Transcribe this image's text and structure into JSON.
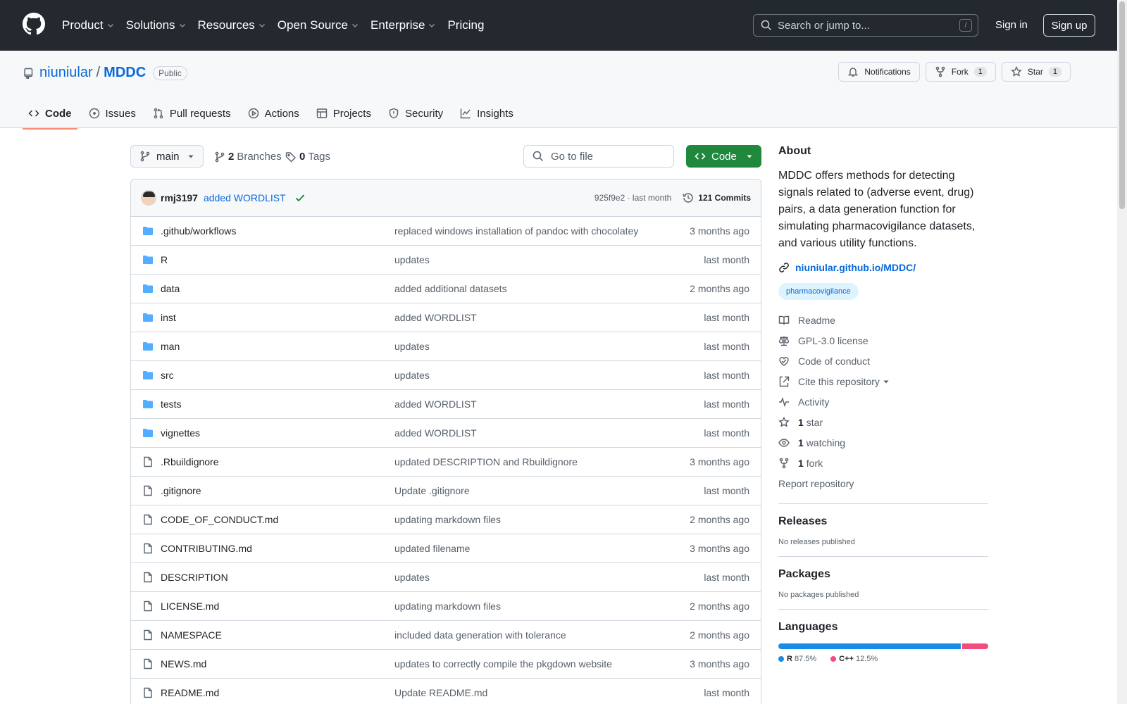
{
  "header": {
    "nav": [
      "Product",
      "Solutions",
      "Resources",
      "Open Source",
      "Enterprise",
      "Pricing"
    ],
    "search_placeholder": "Search or jump to...",
    "search_shortcut": "/",
    "sign_in": "Sign in",
    "sign_up": "Sign up"
  },
  "repo": {
    "owner": "niuniular",
    "separator": "/",
    "name": "MDDC",
    "visibility": "Public",
    "notifications_label": "Notifications",
    "fork_label": "Fork",
    "fork_count": "1",
    "star_label": "Star",
    "star_count": "1"
  },
  "tabs": [
    {
      "label": "Code",
      "icon": "code-icon",
      "active": true
    },
    {
      "label": "Issues",
      "icon": "issue-icon"
    },
    {
      "label": "Pull requests",
      "icon": "pull-request-icon"
    },
    {
      "label": "Actions",
      "icon": "play-icon"
    },
    {
      "label": "Projects",
      "icon": "table-icon"
    },
    {
      "label": "Security",
      "icon": "shield-icon"
    },
    {
      "label": "Insights",
      "icon": "graph-icon"
    }
  ],
  "toolbar": {
    "branch": "main",
    "branches_count": "2",
    "branches_label": "Branches",
    "tags_count": "0",
    "tags_label": "Tags",
    "go_to_file": "Go to file",
    "code_button": "Code"
  },
  "latest_commit": {
    "author": "rmj3197",
    "message": "added WORDLIST",
    "hash_time": "925f9e2 · last month",
    "commits": "121 Commits"
  },
  "files": [
    {
      "name": ".github/workflows",
      "type": "folder",
      "message": "replaced windows installation of pandoc with chocolatey",
      "date": "3 months ago"
    },
    {
      "name": "R",
      "type": "folder",
      "message": "updates",
      "date": "last month"
    },
    {
      "name": "data",
      "type": "folder",
      "message": "added additional datasets",
      "date": "2 months ago"
    },
    {
      "name": "inst",
      "type": "folder",
      "message": "added WORDLIST",
      "date": "last month"
    },
    {
      "name": "man",
      "type": "folder",
      "message": "updates",
      "date": "last month"
    },
    {
      "name": "src",
      "type": "folder",
      "message": "updates",
      "date": "last month"
    },
    {
      "name": "tests",
      "type": "folder",
      "message": "added WORDLIST",
      "date": "last month"
    },
    {
      "name": "vignettes",
      "type": "folder",
      "message": "added WORDLIST",
      "date": "last month"
    },
    {
      "name": ".Rbuildignore",
      "type": "file",
      "message": "updated DESCRIPTION and Rbuildignore",
      "date": "3 months ago"
    },
    {
      "name": ".gitignore",
      "type": "file",
      "message": "Update .gitignore",
      "date": "last month"
    },
    {
      "name": "CODE_OF_CONDUCT.md",
      "type": "file",
      "message": "updating markdown files",
      "date": "2 months ago"
    },
    {
      "name": "CONTRIBUTING.md",
      "type": "file",
      "message": "updated filename",
      "date": "3 months ago"
    },
    {
      "name": "DESCRIPTION",
      "type": "file",
      "message": "updates",
      "date": "last month"
    },
    {
      "name": "LICENSE.md",
      "type": "file",
      "message": "updating markdown files",
      "date": "2 months ago"
    },
    {
      "name": "NAMESPACE",
      "type": "file",
      "message": "included data generation with tolerance",
      "date": "2 months ago"
    },
    {
      "name": "NEWS.md",
      "type": "file",
      "message": "updates to correctly compile the pkgdown website",
      "date": "3 months ago"
    },
    {
      "name": "README.md",
      "type": "file",
      "message": "Update README.md",
      "date": "last month"
    }
  ],
  "about": {
    "heading": "About",
    "description": "MDDC offers methods for detecting signals related to (adverse event, drug) pairs, a data generation function for simulating pharmacovigilance datasets, and various utility functions.",
    "homepage": "niuniular.github.io/MDDC/",
    "topic": "pharmacovigilance",
    "items": [
      {
        "icon": "book-icon",
        "label": "Readme"
      },
      {
        "icon": "law-icon",
        "label": "GPL-3.0 license"
      },
      {
        "icon": "heart-icon",
        "label": "Code of conduct"
      },
      {
        "icon": "cite-icon",
        "label": "Cite this repository"
      },
      {
        "icon": "pulse-icon",
        "label": "Activity"
      },
      {
        "icon": "star-icon",
        "count": "1",
        "label": "star"
      },
      {
        "icon": "eye-icon",
        "count": "1",
        "label": "watching"
      },
      {
        "icon": "fork-icon",
        "count": "1",
        "label": "fork"
      }
    ],
    "report": "Report repository"
  },
  "releases": {
    "heading": "Releases",
    "text": "No releases published"
  },
  "packages": {
    "heading": "Packages",
    "text": "No packages published"
  },
  "languages": {
    "heading": "Languages",
    "items": [
      {
        "name": "R",
        "percent": "87.5%",
        "value": 87.5,
        "color": "#198ce7"
      },
      {
        "name": "C++",
        "percent": "12.5%",
        "value": 12.5,
        "color": "#f34b7d"
      }
    ]
  }
}
